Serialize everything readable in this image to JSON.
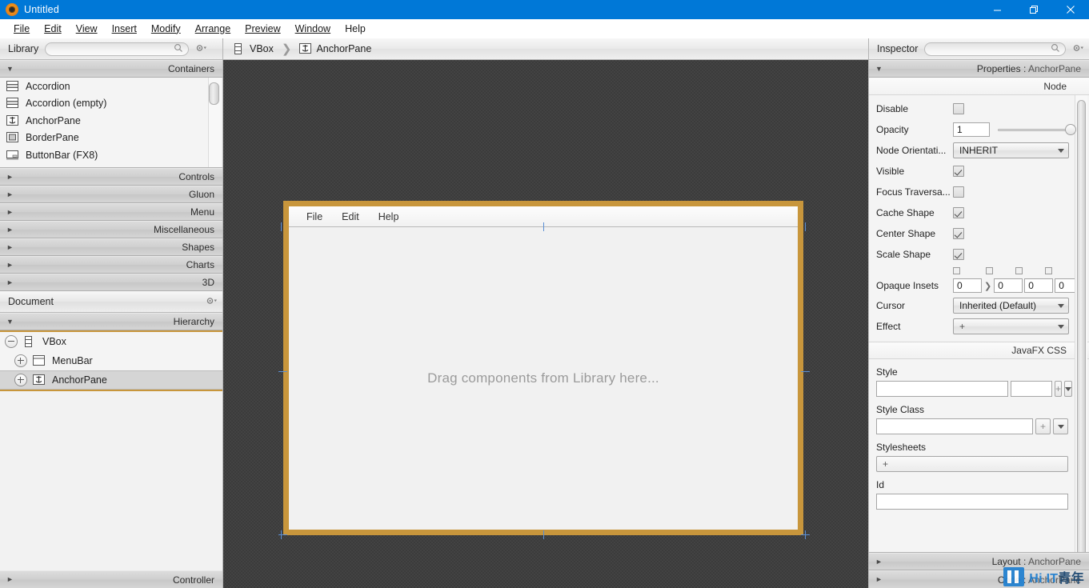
{
  "window": {
    "title": "Untitled",
    "icon": "scenebuilder-icon",
    "controls": {
      "minimize": "minimize-icon",
      "maximize": "maximize-icon",
      "close": "close-icon"
    }
  },
  "menubar": {
    "items": [
      {
        "label": "File",
        "mnemonic": "F"
      },
      {
        "label": "Edit",
        "mnemonic": "E"
      },
      {
        "label": "View",
        "mnemonic": "V"
      },
      {
        "label": "Insert",
        "mnemonic": "I"
      },
      {
        "label": "Modify",
        "mnemonic": "M"
      },
      {
        "label": "Arrange",
        "mnemonic": "A"
      },
      {
        "label": "Preview",
        "mnemonic": "P"
      },
      {
        "label": "Window",
        "mnemonic": "W"
      },
      {
        "label": "Help",
        "mnemonic": ""
      }
    ]
  },
  "library": {
    "title": "Library",
    "search_placeholder": "",
    "search_value": "",
    "gear_label": "gear-icon",
    "section": {
      "label": "Containers",
      "expanded": true
    },
    "items": [
      {
        "label": "Accordion",
        "icon": "accordion-icon"
      },
      {
        "label": "Accordion  (empty)",
        "icon": "accordion-icon"
      },
      {
        "label": "AnchorPane",
        "icon": "anchorpane-icon"
      },
      {
        "label": "BorderPane",
        "icon": "borderpane-icon"
      },
      {
        "label": "ButtonBar  (FX8)",
        "icon": "buttonbar-icon"
      }
    ],
    "categories": [
      {
        "label": "Controls",
        "expanded": false
      },
      {
        "label": "Gluon",
        "expanded": false
      },
      {
        "label": "Menu",
        "expanded": false
      },
      {
        "label": "Miscellaneous",
        "expanded": false
      },
      {
        "label": "Shapes",
        "expanded": false
      },
      {
        "label": "Charts",
        "expanded": false
      },
      {
        "label": "3D",
        "expanded": false
      }
    ]
  },
  "document": {
    "title": "Document",
    "gear_label": "gear-icon",
    "section": {
      "label": "Hierarchy",
      "expanded": true
    },
    "tree": [
      {
        "label": "VBox",
        "icon": "vbox-icon",
        "depth": 0,
        "expander": "minus",
        "selected": false
      },
      {
        "label": "MenuBar",
        "icon": "menubar-icon",
        "depth": 1,
        "expander": "plus",
        "selected": false
      },
      {
        "label": "AnchorPane",
        "icon": "anchorpane-icon",
        "depth": 1,
        "expander": "plus",
        "selected": true
      }
    ],
    "controller_section": {
      "label": "Controller",
      "expanded": false
    }
  },
  "content": {
    "breadcrumb": [
      {
        "label": "VBox",
        "icon": "vbox-icon"
      },
      {
        "label": "AnchorPane",
        "icon": "anchorpane-icon"
      }
    ],
    "stage": {
      "menus": [
        "File",
        "Edit",
        "Help"
      ],
      "drop_hint": "Drag components from Library here...",
      "selection_color": "#c8963c",
      "handle_color": "#5b8fd4"
    }
  },
  "inspector": {
    "title": "Inspector",
    "search_placeholder": "",
    "search_value": "",
    "gear_label": "gear-icon",
    "section": {
      "prefix": "Properties",
      "target": "AnchorPane",
      "expanded": true
    },
    "group_node": "Node",
    "properties": [
      {
        "label": "Disable",
        "type": "checkbox",
        "value": false
      },
      {
        "label": "Opacity",
        "type": "text-slider",
        "value": "1",
        "slider": 100
      },
      {
        "label": "Node Orientati...",
        "type": "combo",
        "value": "INHERIT"
      },
      {
        "label": "Visible",
        "type": "checkbox",
        "value": true
      },
      {
        "label": "Focus Traversa...",
        "type": "checkbox",
        "value": false
      },
      {
        "label": "Cache Shape",
        "type": "checkbox",
        "value": true
      },
      {
        "label": "Center Shape",
        "type": "checkbox",
        "value": true
      },
      {
        "label": "Scale Shape",
        "type": "checkbox",
        "value": true
      }
    ],
    "opaque_insets": {
      "label": "Opaque Insets",
      "values": [
        "0",
        "0",
        "0",
        "0"
      ]
    },
    "cursor": {
      "label": "Cursor",
      "value": "Inherited (Default)"
    },
    "effect": {
      "label": "Effect",
      "value": "+"
    },
    "css_group": "JavaFX CSS",
    "style": {
      "label": "Style",
      "value": "",
      "secondary_value": "",
      "add": "+",
      "menu": "chevron-down-icon"
    },
    "style_class": {
      "label": "Style Class",
      "value": "",
      "add": "+",
      "menu": "chevron-down-icon"
    },
    "stylesheets": {
      "label": "Stylesheets",
      "add": "+"
    },
    "id": {
      "label": "Id",
      "value": ""
    },
    "layout_section": {
      "prefix": "Layout",
      "target": "AnchorPane",
      "expanded": false
    },
    "code_section": {
      "prefix": "Code",
      "target": "AnchorPane",
      "expanded": false
    }
  },
  "watermark": {
    "text_en": "Hi IT",
    "text_cn": "青年"
  },
  "colors": {
    "titlebar": "#0078d7",
    "selection": "#c8963c",
    "handle": "#5b8fd4",
    "canvas": "#3b3b3b",
    "panel": "#f2f2f2"
  }
}
